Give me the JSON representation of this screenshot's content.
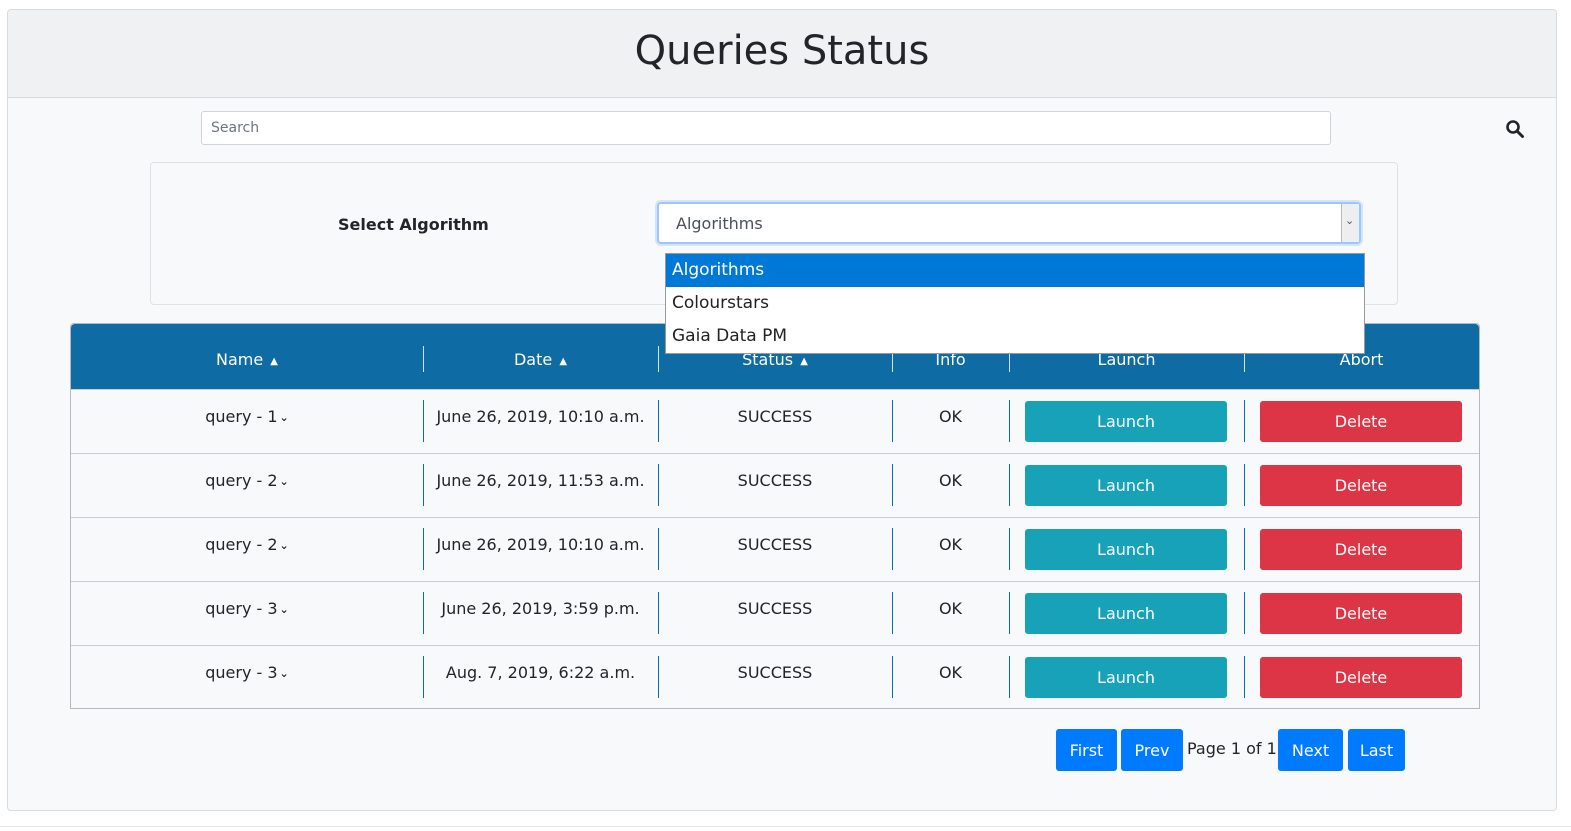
{
  "page": {
    "title": "Queries Status"
  },
  "search": {
    "placeholder": "Search",
    "icon": "search-icon"
  },
  "algorithm_selector": {
    "label": "Select Algorithm",
    "selected": "Algorithms",
    "options": [
      "Algorithms",
      "Colourstars",
      "Gaia Data PM"
    ],
    "highlighted_option": "Algorithms"
  },
  "table": {
    "columns": [
      {
        "label": "Name",
        "sort": "both"
      },
      {
        "label": "Date",
        "sort": "asc"
      },
      {
        "label": "Status",
        "sort": "both"
      },
      {
        "label": "Info",
        "sort": "none"
      },
      {
        "label": "Launch",
        "sort": "none"
      },
      {
        "label": "Abort",
        "sort": "none"
      }
    ],
    "rows": [
      {
        "name": "query - 1",
        "date": "June 26, 2019, 10:10 a.m.",
        "status": "SUCCESS",
        "info": "OK",
        "launch": "Launch",
        "abort": "Delete"
      },
      {
        "name": "query - 2",
        "date": "June 26, 2019, 11:53 a.m.",
        "status": "SUCCESS",
        "info": "OK",
        "launch": "Launch",
        "abort": "Delete"
      },
      {
        "name": "query - 2",
        "date": "June 26, 2019, 10:10 a.m.",
        "status": "SUCCESS",
        "info": "OK",
        "launch": "Launch",
        "abort": "Delete"
      },
      {
        "name": "query - 3",
        "date": "June 26, 2019, 3:59 p.m.",
        "status": "SUCCESS",
        "info": "OK",
        "launch": "Launch",
        "abort": "Delete"
      },
      {
        "name": "query - 3",
        "date": "Aug. 7, 2019, 6:22 a.m.",
        "status": "SUCCESS",
        "info": "OK",
        "launch": "Launch",
        "abort": "Delete"
      }
    ]
  },
  "pagination": {
    "first": "First",
    "prev": "Prev",
    "page_text": "Page 1 of 1",
    "next": "Next",
    "last": "Last"
  },
  "colors": {
    "header_bar": "#0e6ba3",
    "launch_button": "#17a2b8",
    "delete_button": "#dc3545",
    "pager_button": "#007bff",
    "dropdown_highlight": "#0078d7"
  }
}
